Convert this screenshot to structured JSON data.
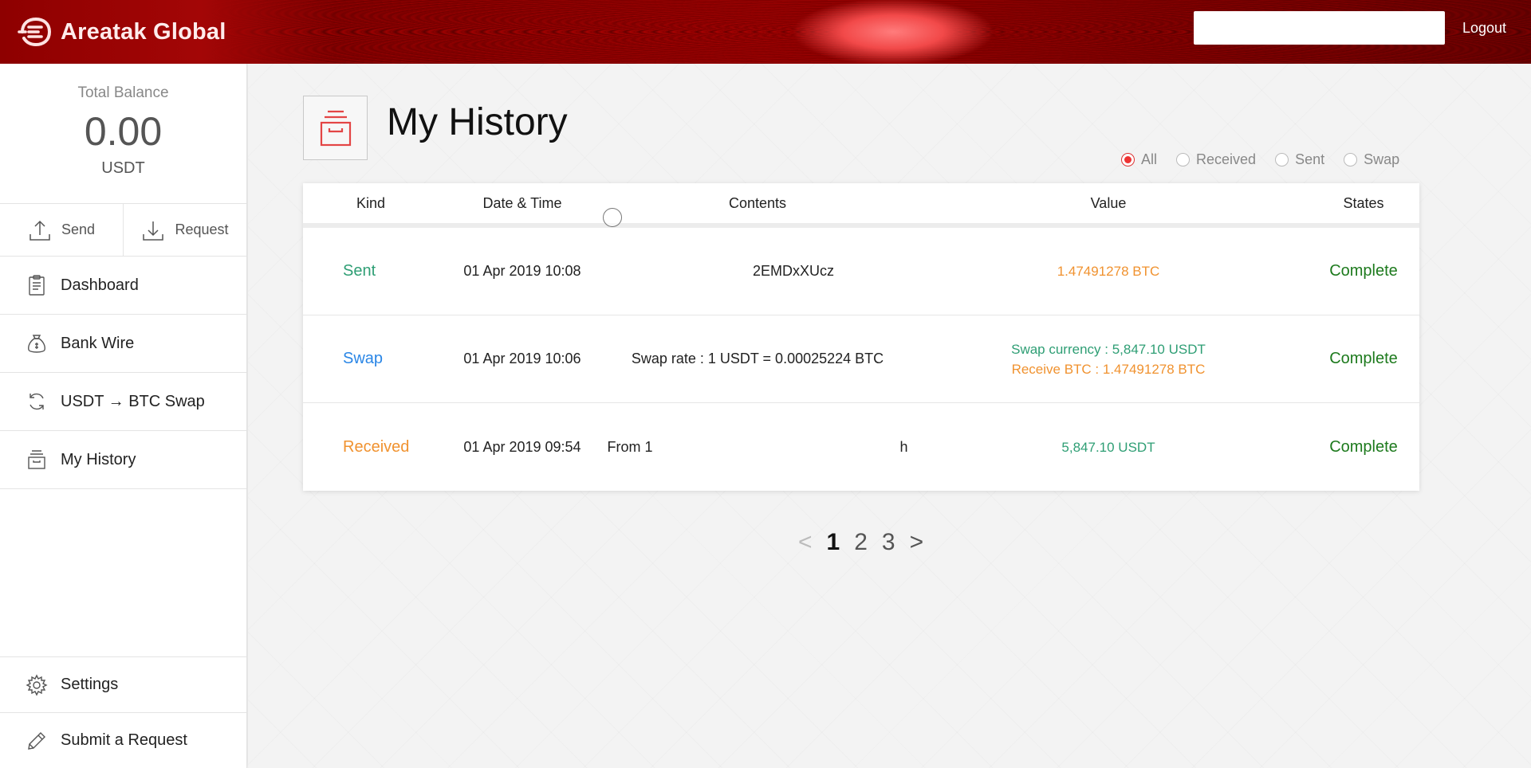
{
  "header": {
    "brand": "Areatak Global",
    "search_value": "",
    "logout_label": "Logout"
  },
  "sidebar": {
    "balance_label": "Total Balance",
    "balance_value": "0.00",
    "balance_unit": "USDT",
    "actions": [
      {
        "label": "Send",
        "icon": "upload-icon"
      },
      {
        "label": "Request",
        "icon": "download-icon"
      }
    ],
    "nav": [
      {
        "label": "Dashboard",
        "icon": "clipboard-icon"
      },
      {
        "label": "Bank Wire",
        "icon": "money-bag-icon"
      },
      {
        "label": "USDT → BTC Swap",
        "icon": "swap-icon"
      },
      {
        "label": "My History",
        "icon": "archive-icon"
      }
    ],
    "bottom_nav": [
      {
        "label": "Settings",
        "icon": "gear-icon"
      },
      {
        "label": "Submit a Request",
        "icon": "pencil-icon"
      }
    ]
  },
  "main": {
    "title": "My History",
    "filters": [
      {
        "label": "All",
        "checked": true
      },
      {
        "label": "Received",
        "checked": false
      },
      {
        "label": "Sent",
        "checked": false
      },
      {
        "label": "Swap",
        "checked": false
      }
    ],
    "table": {
      "columns": [
        "Kind",
        "Date & Time",
        "Contents",
        "Value",
        "States"
      ],
      "rows": [
        {
          "kind": "Sent",
          "date": "01 Apr 2019 10:08",
          "contents": "                  2EMDxXUcz",
          "value_line1": "1.47491278 BTC",
          "value_line2": "",
          "state": "Complete"
        },
        {
          "kind": "Swap",
          "date": "01 Apr 2019 10:06",
          "contents": "Swap rate : 1 USDT = 0.00025224 BTC",
          "value_line1": "Swap currency : 5,847.10 USDT",
          "value_line2": "Receive BTC : 1.47491278 BTC",
          "state": "Complete"
        },
        {
          "kind": "Received",
          "date": "01 Apr 2019 09:54",
          "contents": "From 1                                                              h",
          "value_line1": "5,847.10 USDT",
          "value_line2": "",
          "state": "Complete"
        }
      ]
    },
    "pagination": {
      "prev": "<",
      "pages": [
        "1",
        "2",
        "3"
      ],
      "current": "1",
      "next": ">"
    }
  },
  "colors": {
    "accent": "#e33333",
    "sent": "#2e9e74",
    "swap": "#2a86e6",
    "received": "#f0922f",
    "complete": "#1d7a1d"
  }
}
